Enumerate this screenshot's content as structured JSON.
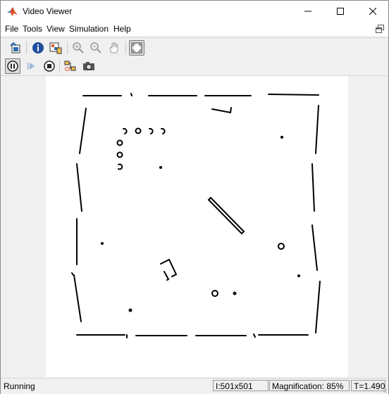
{
  "window": {
    "title": "Video Viewer",
    "minimize_icon": "minimize-icon",
    "maximize_icon": "maximize-icon",
    "close_icon": "close-icon"
  },
  "menu": {
    "items": [
      "File",
      "Tools",
      "View",
      "Simulation",
      "Help"
    ],
    "dock_icon": "dock-icon"
  },
  "toolbar1": {
    "icons": [
      "print-to-figure-icon",
      "info-icon",
      "colormap-icon",
      "zoom-in-icon",
      "zoom-out-icon",
      "pan-icon",
      "fit-to-window-icon"
    ]
  },
  "toolbar2": {
    "icons": [
      "pause-icon",
      "step-forward-icon",
      "stop-icon",
      "highlight-simulink-block-icon",
      "snapshot-icon"
    ]
  },
  "status": {
    "state": "Running",
    "image_size": "I:501x501",
    "magnification": "Magnification: 85%",
    "time": "T=1.490"
  },
  "colors": {
    "window_bg": "#f0f0f0",
    "titlebar_bg": "#ffffff",
    "frame_bg": "#ffffff",
    "map_ink": "#000000",
    "matlab_orange": "#e4572e"
  }
}
